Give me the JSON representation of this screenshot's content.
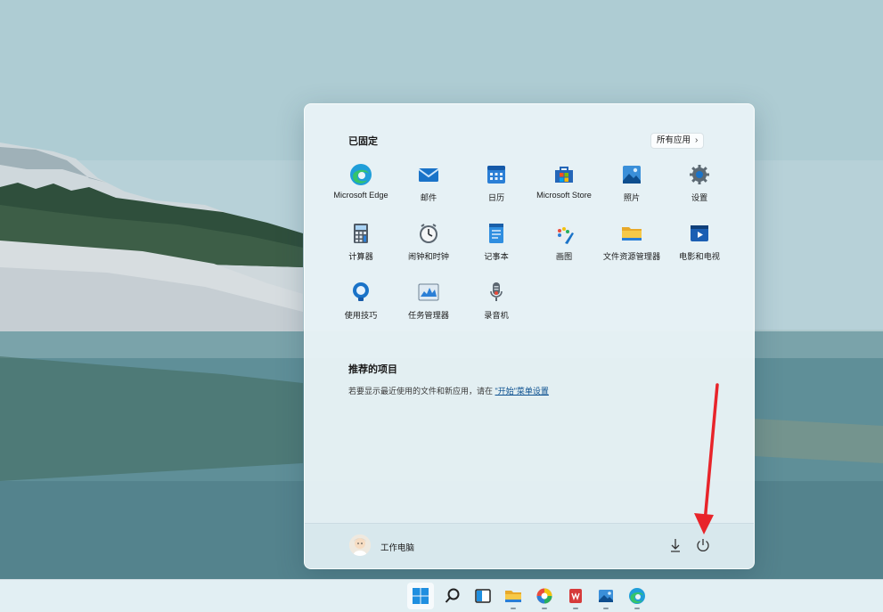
{
  "start_menu": {
    "pinned_heading": "已固定",
    "all_apps_label": "所有应用",
    "pinned_apps": [
      {
        "label": "Microsoft Edge",
        "icon": "edge-icon"
      },
      {
        "label": "邮件",
        "icon": "mail-icon"
      },
      {
        "label": "日历",
        "icon": "calendar-icon"
      },
      {
        "label": "Microsoft Store",
        "icon": "store-icon"
      },
      {
        "label": "照片",
        "icon": "photos-icon"
      },
      {
        "label": "设置",
        "icon": "gear-icon"
      },
      {
        "label": "计算器",
        "icon": "calculator-icon"
      },
      {
        "label": "闹钟和时钟",
        "icon": "clock-icon"
      },
      {
        "label": "记事本",
        "icon": "notepad-icon"
      },
      {
        "label": "画图",
        "icon": "paint-icon"
      },
      {
        "label": "文件资源管理器",
        "icon": "folder-icon"
      },
      {
        "label": "电影和电视",
        "icon": "movies-icon"
      },
      {
        "label": "使用技巧",
        "icon": "tips-icon"
      },
      {
        "label": "任务管理器",
        "icon": "task-manager-icon"
      },
      {
        "label": "录音机",
        "icon": "recorder-icon"
      }
    ],
    "recommended_heading": "推荐的项目",
    "recommended_text": "若要显示最近使用的文件和新应用，请在 ",
    "recommended_link": "\"开始\"菜单设置",
    "user_name": "工作电脑"
  },
  "taskbar": {
    "items": [
      "start-icon",
      "search-icon",
      "task-view-icon",
      "file-explorer-icon",
      "color-app-icon",
      "wps-icon",
      "photos-icon",
      "edge-icon"
    ]
  },
  "colors": {
    "accent": "#0067c0",
    "annotation_arrow": "#e8242a"
  }
}
